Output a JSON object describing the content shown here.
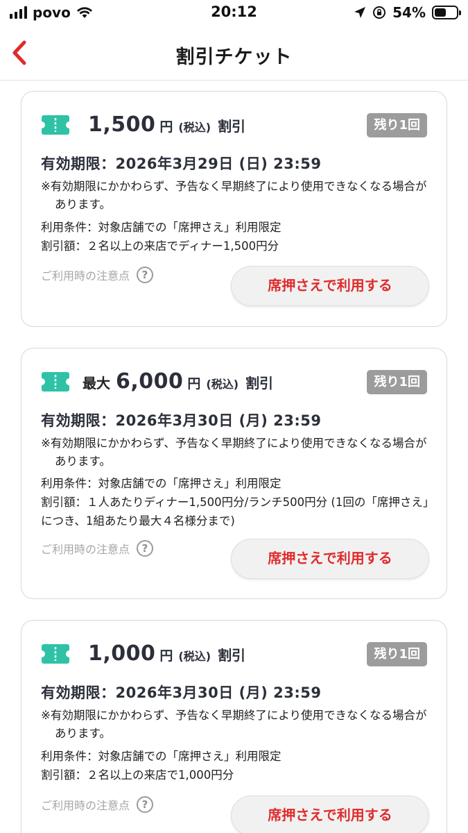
{
  "status_bar": {
    "carrier": "povo",
    "time": "20:12",
    "battery": "54%"
  },
  "header": {
    "title": "割引チケット"
  },
  "tickets": [
    {
      "prefix": "",
      "amount": "1,500",
      "yen": "円",
      "tax": "(税込)",
      "discount_label": "割引",
      "remaining": "残り1回",
      "expiry": "有効期限：2026年3月29日 (日) 23:59",
      "note": "※有効期限にかかわらず、予告なく早期終了により使用できなくなる場合があります。",
      "condition": "利用条件：対象店舗での「席押さえ」利用限定",
      "discount_detail": "割引額：２名以上の来店でディナー1,500円分",
      "caution": "ご利用時の注意点",
      "button": "席押さえで利用する"
    },
    {
      "prefix": "最大",
      "amount": "6,000",
      "yen": "円",
      "tax": "(税込)",
      "discount_label": "割引",
      "remaining": "残り1回",
      "expiry": "有効期限：2026年3月30日 (月) 23:59",
      "note": "※有効期限にかかわらず、予告なく早期終了により使用できなくなる場合があります。",
      "condition": "利用条件：対象店舗での「席押さえ」利用限定",
      "discount_detail": "割引額：１人あたりディナー1,500円分/ランチ500円分 (1回の「席押さえ」につき、1組あたり最大４名様分まで)",
      "caution": "ご利用時の注意点",
      "button": "席押さえで利用する"
    },
    {
      "prefix": "",
      "amount": "1,000",
      "yen": "円",
      "tax": "(税込)",
      "discount_label": "割引",
      "remaining": "残り1回",
      "expiry": "有効期限：2026年3月30日 (月) 23:59",
      "note": "※有効期限にかかわらず、予告なく早期終了により使用できなくなる場合があります。",
      "condition": "利用条件：対象店舗での「席押さえ」利用限定",
      "discount_detail": "割引額：２名以上の来店で1,000円分",
      "caution": "ご利用時の注意点",
      "button": "席押さえで利用する"
    }
  ],
  "colors": {
    "accent_red": "#e02a2a",
    "ticket_icon": "#2fc2a6",
    "badge": "#9c9c9c"
  }
}
